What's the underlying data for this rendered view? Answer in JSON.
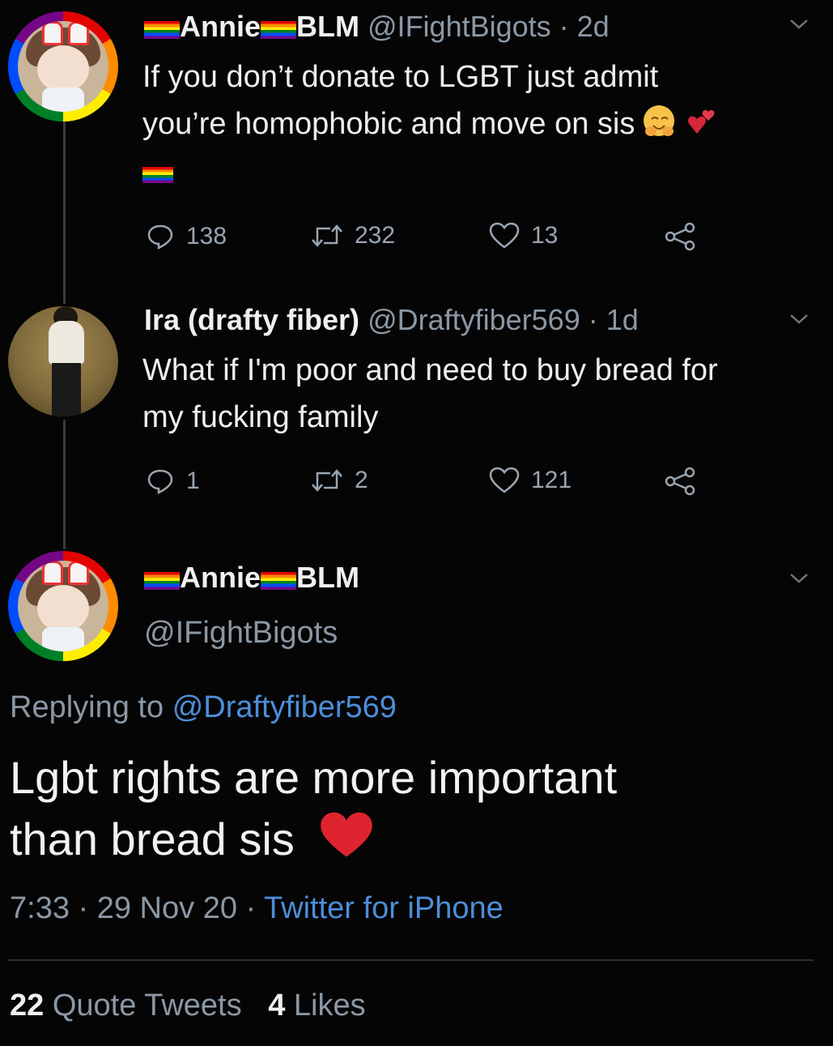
{
  "tweet1": {
    "name_a": "Annie",
    "name_b": "BLM",
    "handle": "@IFightBigots",
    "age": "· 2d",
    "line1": "If you don’t donate to LGBT just admit",
    "line2": "you’re homophobic and move on sis",
    "replies": "138",
    "retweets": "232",
    "likes": "13"
  },
  "tweet2": {
    "name": "Ira (drafty fiber)",
    "handle": "@Draftyfiber569",
    "age": "· 1d",
    "line1": "What if I'm poor and need to buy bread for",
    "line2": "my fucking family",
    "replies": "1",
    "retweets": "2",
    "likes": "121"
  },
  "main": {
    "name_a": "Annie",
    "name_b": "BLM",
    "handle": "@IFightBigots",
    "replying_prefix": "Replying to",
    "replying_to": "@Draftyfiber569",
    "line1": "Lgbt rights are more important",
    "line2": "than bread sis",
    "time": "7:33 · 29 Nov 20 ·",
    "client": "Twitter for iPhone",
    "quote_count": "22",
    "quote_label": "Quote Tweets",
    "like_count": "4",
    "like_label": "Likes"
  },
  "colors": {
    "background": "#050505",
    "link": "#4c8ed9",
    "heart": "#e0242f"
  }
}
